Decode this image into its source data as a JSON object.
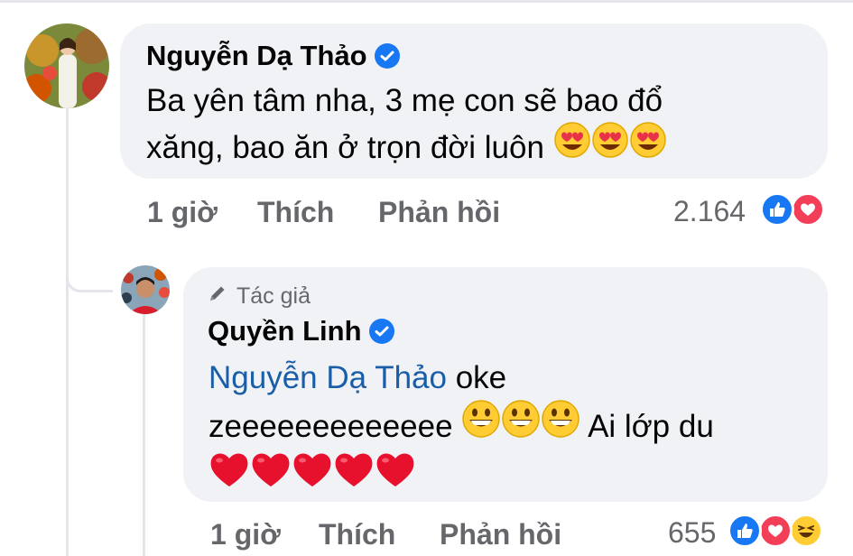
{
  "comment": {
    "author": "Nguyễn Dạ Thảo",
    "line1": "Ba yên tâm nha, 3 mẹ con  sẽ bao đổ",
    "line2": "xăng, bao ăn ở trọn đời luôn",
    "emoji": "heart-eyes-icon x3",
    "time": "1 giờ",
    "like_label": "Thích",
    "reply_label": "Phản hồi",
    "reaction_count": "2.164",
    "reactions": [
      "like",
      "love"
    ]
  },
  "reply": {
    "badge": "Tác giả",
    "author": "Quyền Linh",
    "mention": "Nguyễn Dạ Thảo",
    "text1": " oke",
    "text2": "zeeeeeeeeeeeee",
    "text2_suffix": " Ai lớp du",
    "emoji": "grinning-face-icon x3, red-heart-icon x5",
    "time": "1 giờ",
    "like_label": "Thích",
    "reply_label": "Phản hồi",
    "reaction_count": "655",
    "reactions": [
      "like",
      "love",
      "haha"
    ]
  },
  "colors": {
    "bubble": "#f0f2f5",
    "secondary_text": "#65676b",
    "mention": "#1a5ea8",
    "like_blue": "#1877f2",
    "love_red": "#f33e58"
  }
}
